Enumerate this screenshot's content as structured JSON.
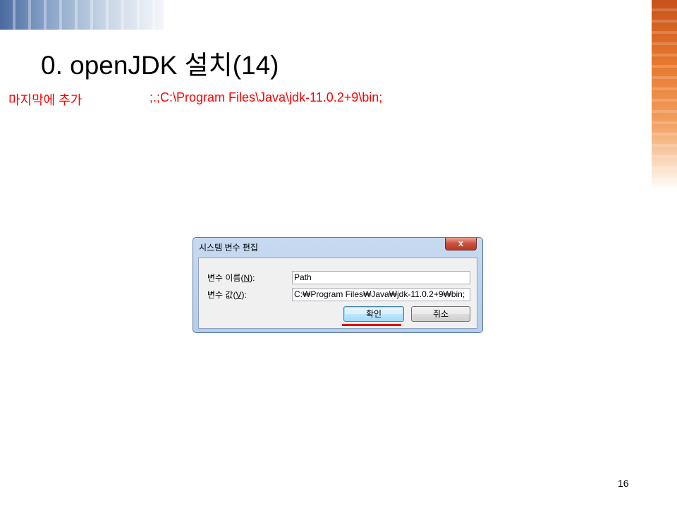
{
  "slide": {
    "title": "0. openJDK 설치(14)",
    "note_label": "마지막에 추가",
    "note_path": ";.;C:\\Program Files\\Java\\jdk-11.0.2+9\\bin;",
    "page_number": "16"
  },
  "dialog": {
    "title": "시스템 변수 편집",
    "close_glyph": "x",
    "name_label_prefix": "변수 이름(",
    "name_label_key": "N",
    "name_label_suffix": "):",
    "value_label_prefix": "변수 값(",
    "value_label_key": "V",
    "value_label_suffix": "):",
    "name_value": "Path",
    "value_value": "C:₩Program Files₩Java₩jdk-11.0.2+9₩bin;",
    "ok_label": "확인",
    "cancel_label": "취소"
  },
  "colors": {
    "annotation_red": "#ff0000",
    "highlight_underline": "#e00000"
  }
}
